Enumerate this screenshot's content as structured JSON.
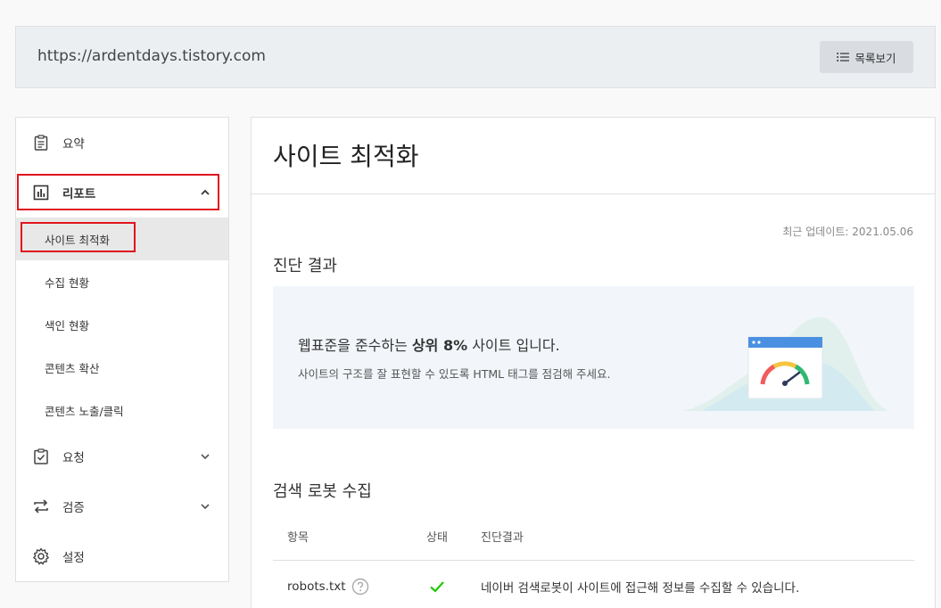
{
  "site_bar": {
    "url": "https://ardentdays.tistory.com",
    "list_button_label": "목록보기"
  },
  "sidebar": {
    "items": [
      {
        "label": "요약",
        "icon": "clipboard-icon"
      },
      {
        "label": "리포트",
        "icon": "bar-chart-icon",
        "expanded": true
      },
      {
        "label": "요청",
        "icon": "clipboard-check-icon"
      },
      {
        "label": "검증",
        "icon": "arrows-swap-icon"
      },
      {
        "label": "설정",
        "icon": "gear-icon"
      }
    ],
    "report_sub_items": [
      {
        "label": "사이트 최적화",
        "active": true
      },
      {
        "label": "수집 현황"
      },
      {
        "label": "색인 현황"
      },
      {
        "label": "콘텐츠 확산"
      },
      {
        "label": "콘텐츠 노출/클릭"
      }
    ]
  },
  "main": {
    "title": "사이트 최적화",
    "updated": "최근 업데이트: 2021.05.06",
    "diagnosis": {
      "section_title": "진단 결과",
      "message_prefix": "웹표준을 준수하는 ",
      "message_highlight": "상위 8%",
      "message_suffix": " 사이트 입니다.",
      "sub_message": "사이트의 구조를 잘 표현할 수 있도록 HTML 태그를 점검해 주세요."
    },
    "robot": {
      "section_title": "검색 로봇 수집",
      "columns": [
        "항목",
        "상태",
        "진단결과"
      ],
      "rows": [
        {
          "item": "robots.txt",
          "status": "ok",
          "result": "네이버 검색로봇이 사이트에 접근해 정보를 수집할 수 있습니다."
        }
      ]
    }
  },
  "colors": {
    "highlight_border": "#e0141e",
    "check_green": "#1ec800",
    "diagnosis_bg": "#f2f6fa"
  }
}
